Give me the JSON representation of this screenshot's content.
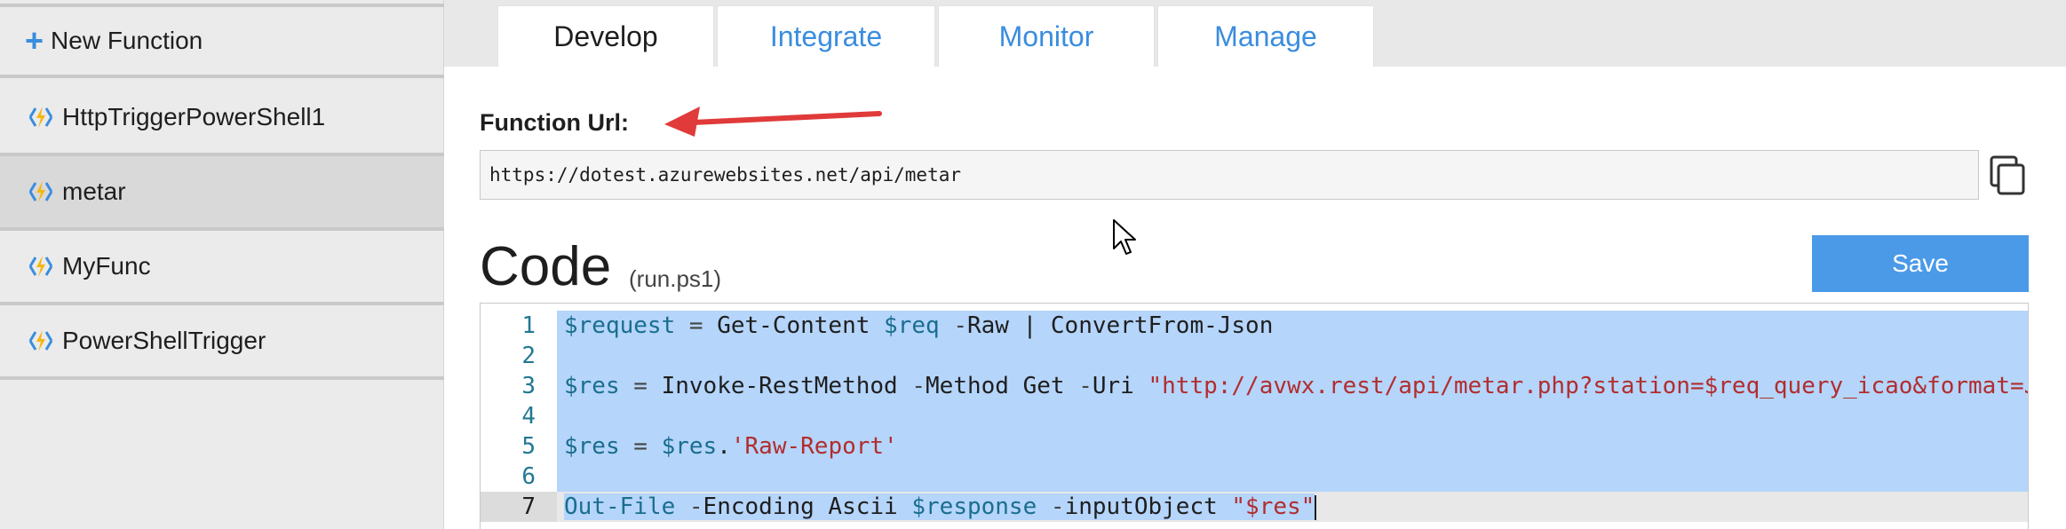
{
  "sidebar": {
    "new_function": "New Function",
    "items": [
      {
        "label": "HttpTriggerPowerShell1",
        "selected": false
      },
      {
        "label": "metar",
        "selected": true
      },
      {
        "label": "MyFunc",
        "selected": false
      },
      {
        "label": "PowerShellTrigger",
        "selected": false
      }
    ]
  },
  "tabs": [
    {
      "label": "Develop",
      "active": true
    },
    {
      "label": "Integrate",
      "active": false
    },
    {
      "label": "Monitor",
      "active": false
    },
    {
      "label": "Manage",
      "active": false
    }
  ],
  "function_url": {
    "label": "Function Url:",
    "value": "https://dotest.azurewebsites.net/api/metar"
  },
  "code": {
    "title": "Code",
    "file": "(run.ps1)",
    "save_label": "Save",
    "line_numbers": [
      "1",
      "2",
      "3",
      "4",
      "5",
      "6",
      "7"
    ],
    "lines": [
      [
        {
          "t": "var",
          "s": "$request"
        },
        {
          "t": "op",
          "s": " = "
        },
        {
          "t": "txt",
          "s": "Get-Content "
        },
        {
          "t": "var",
          "s": "$req"
        },
        {
          "t": "op",
          "s": " -"
        },
        {
          "t": "txt",
          "s": "Raw | ConvertFrom-Json"
        }
      ],
      [],
      [
        {
          "t": "var",
          "s": "$res"
        },
        {
          "t": "op",
          "s": " = "
        },
        {
          "t": "txt",
          "s": "Invoke-RestMethod "
        },
        {
          "t": "op",
          "s": "-"
        },
        {
          "t": "txt",
          "s": "Method Get "
        },
        {
          "t": "op",
          "s": "-"
        },
        {
          "t": "txt",
          "s": "Uri "
        },
        {
          "t": "str",
          "s": "\"http://avwx.rest/api/metar.php?station=$req_query_icao&format=JS"
        }
      ],
      [],
      [
        {
          "t": "var",
          "s": "$res"
        },
        {
          "t": "op",
          "s": " = "
        },
        {
          "t": "var",
          "s": "$res"
        },
        {
          "t": "txt",
          "s": "."
        },
        {
          "t": "str",
          "s": "'Raw-Report'"
        }
      ],
      [],
      [
        {
          "t": "var",
          "s": "Out-File"
        },
        {
          "t": "op",
          "s": " -"
        },
        {
          "t": "txt",
          "s": "Encoding Ascii "
        },
        {
          "t": "var",
          "s": "$response"
        },
        {
          "t": "op",
          "s": " -"
        },
        {
          "t": "txt",
          "s": "inputObject "
        },
        {
          "t": "str",
          "s": "\"$res\""
        }
      ]
    ]
  },
  "colors": {
    "accent": "#3a8dde",
    "save_button": "#4a9ae8",
    "selection": "#b5d5fb",
    "bolt": "#f5b60f"
  },
  "icons": {
    "new": "plus-icon",
    "function": "bolt-icon",
    "copy": "copy-icon"
  }
}
